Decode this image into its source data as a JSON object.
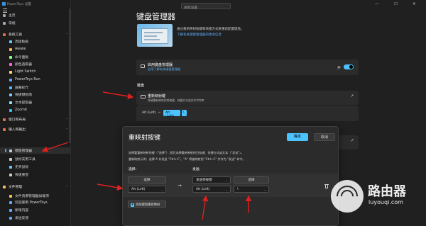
{
  "app": {
    "title": "PowerToys 设置",
    "search_placeholder": "搜索设置"
  },
  "window_controls": {
    "minimize": "—",
    "maximize": "☐",
    "close": "✕"
  },
  "sidebar": {
    "items": [
      {
        "label": "主页",
        "icon": "home-icon"
      },
      {
        "label": "常规",
        "icon": "gear-icon"
      },
      {
        "label": "系统工具",
        "icon": "tools-icon",
        "group": true
      },
      {
        "label": "高级粘贴",
        "icon": "paste-icon"
      },
      {
        "label": "Awake",
        "icon": "coffee-icon"
      },
      {
        "label": "命令面板",
        "icon": "command-icon"
      },
      {
        "label": "颜色选取器",
        "icon": "color-picker-icon"
      },
      {
        "label": "Light Switch",
        "icon": "sun-icon"
      },
      {
        "label": "PowerToys Run",
        "icon": "run-icon"
      },
      {
        "label": "屏幕标尺",
        "icon": "ruler-icon"
      },
      {
        "label": "快捷键指南",
        "icon": "shortcut-icon"
      },
      {
        "label": "文本提取器",
        "icon": "text-extract-icon"
      },
      {
        "label": "ZoomIt",
        "icon": "zoom-icon"
      },
      {
        "label": "窗口和布局",
        "icon": "window-icon",
        "group": true
      },
      {
        "label": "输入和输出",
        "icon": "input-icon",
        "group": true
      },
      {
        "label": "键盘管理器",
        "icon": "keyboard-icon",
        "selected": true
      },
      {
        "label": "鼠标实用工具",
        "icon": "mouse-icon"
      },
      {
        "label": "无界鼠标",
        "icon": "mouse-without-borders-icon"
      },
      {
        "label": "快速重音",
        "icon": "accent-icon"
      },
      {
        "label": "文件管理",
        "icon": "folder-icon",
        "group": true
      },
      {
        "label": "文件资源管理器加载项",
        "icon": "explorer-icon"
      },
      {
        "label": "欢迎使用 PowerToys",
        "icon": "welcome-icon"
      },
      {
        "label": "新增内容",
        "icon": "new-icon"
      },
      {
        "label": "发送反馈",
        "icon": "feedback-icon"
      }
    ]
  },
  "main": {
    "page_title": "键盘管理器",
    "description": "通过重新映射按键和快捷方式来重新配置键盘。",
    "learn_more": "了解有关键盘管理器的更多信息",
    "enable": {
      "title": "启用键盘管理器",
      "subtitle": "启用了解有关键盘管理器",
      "state_label": "开"
    },
    "keyboard_section": "键盘",
    "remap": {
      "title": "重新映射键",
      "subtitle": "将键重新映射到其他键、快捷方式或文本字符串"
    },
    "mapping": {
      "from": "Alt (Left)",
      "to": "Alt (Left)",
      "to_key": "\\"
    }
  },
  "dialog": {
    "title": "重映射按键",
    "ok": "确定",
    "cancel": "取消",
    "line1": "选择要重新映射的键（\"选择\"）,然后选择重新映射的目标键、快捷方式或文本（\"发送\"）。",
    "line2": "重新映射示例：选择 A 并发送 \"Ctrl+C\"。\"A\" 将被映射到 \"Ctrl+C\" 并作为 \"发送\" 命令。",
    "col_select": "选择:",
    "col_send": "发送:",
    "row": {
      "select_button": "选择",
      "select_value": "Alt (Left)",
      "send_type": "发送到按键",
      "send_button": "选择",
      "send_value_1": "Alt (Left)",
      "send_value_2": "\\"
    },
    "add_button": "添加键盘重新映射",
    "plus": "+"
  },
  "watermark": {
    "title": "路由器",
    "url": "luyouqi.com"
  },
  "colors": {
    "accent": "#4cc2ff",
    "arrow": "#e02020",
    "background": "#202020",
    "card": "#2b2b2b"
  }
}
